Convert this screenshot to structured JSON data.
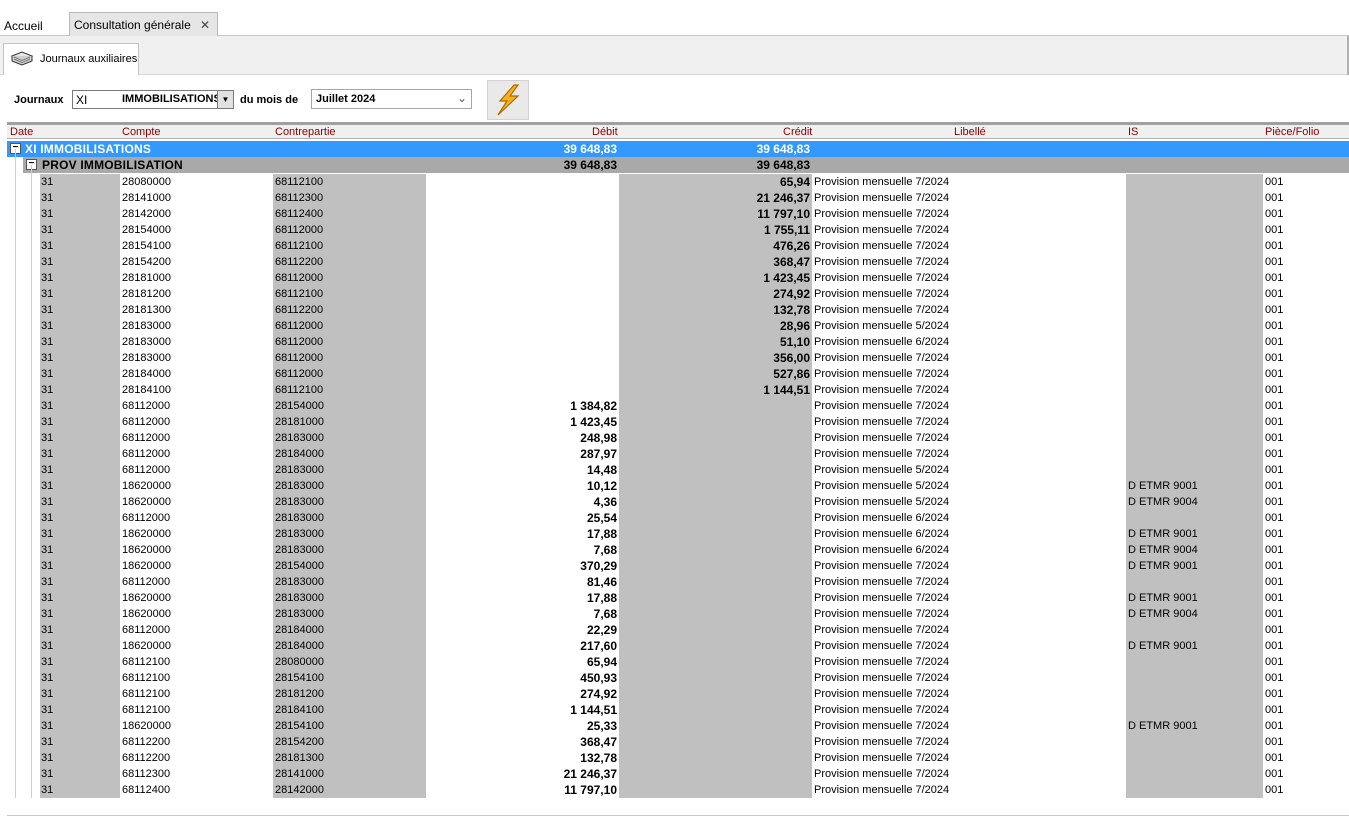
{
  "tabs": {
    "home": "Accueil",
    "active": "Consultation générale",
    "close": "✕"
  },
  "subtab": {
    "label": "Journaux auxiliaires"
  },
  "filters": {
    "journaux_label": "Journaux",
    "journal_code": "XI",
    "journal_name": "IMMOBILISATIONS",
    "mois_label": "du mois de",
    "mois_value": "Juillet 2024"
  },
  "columns": [
    "Date",
    "Compte",
    "Contrepartie",
    "Débit",
    "Crédit",
    "Libellé",
    "IS",
    "Pièce/Folio"
  ],
  "group1": {
    "label": "XI IMMOBILISATIONS",
    "debit": "39 648,83",
    "credit": "39 648,83"
  },
  "group2": {
    "label": "PROV IMMOBILISATION",
    "debit": "39 648,83",
    "credit": "39 648,83"
  },
  "rows": [
    {
      "date": "31",
      "compte": "28080000",
      "contre": "68112100",
      "debit": "",
      "credit": "65,94",
      "libelle": "Provision mensuelle 7/2024",
      "is": "",
      "piece": "001"
    },
    {
      "date": "31",
      "compte": "28141000",
      "contre": "68112300",
      "debit": "",
      "credit": "21 246,37",
      "libelle": "Provision mensuelle 7/2024",
      "is": "",
      "piece": "001"
    },
    {
      "date": "31",
      "compte": "28142000",
      "contre": "68112400",
      "debit": "",
      "credit": "11 797,10",
      "libelle": "Provision mensuelle 7/2024",
      "is": "",
      "piece": "001"
    },
    {
      "date": "31",
      "compte": "28154000",
      "contre": "68112000",
      "debit": "",
      "credit": "1 755,11",
      "libelle": "Provision mensuelle 7/2024",
      "is": "",
      "piece": "001"
    },
    {
      "date": "31",
      "compte": "28154100",
      "contre": "68112100",
      "debit": "",
      "credit": "476,26",
      "libelle": "Provision mensuelle 7/2024",
      "is": "",
      "piece": "001"
    },
    {
      "date": "31",
      "compte": "28154200",
      "contre": "68112200",
      "debit": "",
      "credit": "368,47",
      "libelle": "Provision mensuelle 7/2024",
      "is": "",
      "piece": "001"
    },
    {
      "date": "31",
      "compte": "28181000",
      "contre": "68112000",
      "debit": "",
      "credit": "1 423,45",
      "libelle": "Provision mensuelle 7/2024",
      "is": "",
      "piece": "001"
    },
    {
      "date": "31",
      "compte": "28181200",
      "contre": "68112100",
      "debit": "",
      "credit": "274,92",
      "libelle": "Provision mensuelle 7/2024",
      "is": "",
      "piece": "001"
    },
    {
      "date": "31",
      "compte": "28181300",
      "contre": "68112200",
      "debit": "",
      "credit": "132,78",
      "libelle": "Provision mensuelle 7/2024",
      "is": "",
      "piece": "001"
    },
    {
      "date": "31",
      "compte": "28183000",
      "contre": "68112000",
      "debit": "",
      "credit": "28,96",
      "libelle": "Provision mensuelle 5/2024",
      "is": "",
      "piece": "001"
    },
    {
      "date": "31",
      "compte": "28183000",
      "contre": "68112000",
      "debit": "",
      "credit": "51,10",
      "libelle": "Provision mensuelle 6/2024",
      "is": "",
      "piece": "001"
    },
    {
      "date": "31",
      "compte": "28183000",
      "contre": "68112000",
      "debit": "",
      "credit": "356,00",
      "libelle": "Provision mensuelle 7/2024",
      "is": "",
      "piece": "001"
    },
    {
      "date": "31",
      "compte": "28184000",
      "contre": "68112000",
      "debit": "",
      "credit": "527,86",
      "libelle": "Provision mensuelle 7/2024",
      "is": "",
      "piece": "001"
    },
    {
      "date": "31",
      "compte": "28184100",
      "contre": "68112100",
      "debit": "",
      "credit": "1 144,51",
      "libelle": "Provision mensuelle 7/2024",
      "is": "",
      "piece": "001"
    },
    {
      "date": "31",
      "compte": "68112000",
      "contre": "28154000",
      "debit": "1 384,82",
      "credit": "",
      "libelle": "Provision mensuelle 7/2024",
      "is": "",
      "piece": "001"
    },
    {
      "date": "31",
      "compte": "68112000",
      "contre": "28181000",
      "debit": "1 423,45",
      "credit": "",
      "libelle": "Provision mensuelle 7/2024",
      "is": "",
      "piece": "001"
    },
    {
      "date": "31",
      "compte": "68112000",
      "contre": "28183000",
      "debit": "248,98",
      "credit": "",
      "libelle": "Provision mensuelle 7/2024",
      "is": "",
      "piece": "001"
    },
    {
      "date": "31",
      "compte": "68112000",
      "contre": "28184000",
      "debit": "287,97",
      "credit": "",
      "libelle": "Provision mensuelle 7/2024",
      "is": "",
      "piece": "001"
    },
    {
      "date": "31",
      "compte": "68112000",
      "contre": "28183000",
      "debit": "14,48",
      "credit": "",
      "libelle": "Provision mensuelle 5/2024",
      "is": "",
      "piece": "001"
    },
    {
      "date": "31",
      "compte": "18620000",
      "contre": "28183000",
      "debit": "10,12",
      "credit": "",
      "libelle": "Provision mensuelle 5/2024",
      "is": "D ETMR 9001",
      "piece": "001"
    },
    {
      "date": "31",
      "compte": "18620000",
      "contre": "28183000",
      "debit": "4,36",
      "credit": "",
      "libelle": "Provision mensuelle 5/2024",
      "is": "D ETMR 9004",
      "piece": "001"
    },
    {
      "date": "31",
      "compte": "68112000",
      "contre": "28183000",
      "debit": "25,54",
      "credit": "",
      "libelle": "Provision mensuelle 6/2024",
      "is": "",
      "piece": "001"
    },
    {
      "date": "31",
      "compte": "18620000",
      "contre": "28183000",
      "debit": "17,88",
      "credit": "",
      "libelle": "Provision mensuelle 6/2024",
      "is": "D ETMR 9001",
      "piece": "001"
    },
    {
      "date": "31",
      "compte": "18620000",
      "contre": "28183000",
      "debit": "7,68",
      "credit": "",
      "libelle": "Provision mensuelle 6/2024",
      "is": "D ETMR 9004",
      "piece": "001"
    },
    {
      "date": "31",
      "compte": "18620000",
      "contre": "28154000",
      "debit": "370,29",
      "credit": "",
      "libelle": "Provision mensuelle 7/2024",
      "is": "D ETMR 9001",
      "piece": "001"
    },
    {
      "date": "31",
      "compte": "68112000",
      "contre": "28183000",
      "debit": "81,46",
      "credit": "",
      "libelle": "Provision mensuelle 7/2024",
      "is": "",
      "piece": "001"
    },
    {
      "date": "31",
      "compte": "18620000",
      "contre": "28183000",
      "debit": "17,88",
      "credit": "",
      "libelle": "Provision mensuelle 7/2024",
      "is": "D ETMR 9001",
      "piece": "001"
    },
    {
      "date": "31",
      "compte": "18620000",
      "contre": "28183000",
      "debit": "7,68",
      "credit": "",
      "libelle": "Provision mensuelle 7/2024",
      "is": "D ETMR 9004",
      "piece": "001"
    },
    {
      "date": "31",
      "compte": "68112000",
      "contre": "28184000",
      "debit": "22,29",
      "credit": "",
      "libelle": "Provision mensuelle 7/2024",
      "is": "",
      "piece": "001"
    },
    {
      "date": "31",
      "compte": "18620000",
      "contre": "28184000",
      "debit": "217,60",
      "credit": "",
      "libelle": "Provision mensuelle 7/2024",
      "is": "D ETMR 9001",
      "piece": "001"
    },
    {
      "date": "31",
      "compte": "68112100",
      "contre": "28080000",
      "debit": "65,94",
      "credit": "",
      "libelle": "Provision mensuelle 7/2024",
      "is": "",
      "piece": "001"
    },
    {
      "date": "31",
      "compte": "68112100",
      "contre": "28154100",
      "debit": "450,93",
      "credit": "",
      "libelle": "Provision mensuelle 7/2024",
      "is": "",
      "piece": "001"
    },
    {
      "date": "31",
      "compte": "68112100",
      "contre": "28181200",
      "debit": "274,92",
      "credit": "",
      "libelle": "Provision mensuelle 7/2024",
      "is": "",
      "piece": "001"
    },
    {
      "date": "31",
      "compte": "68112100",
      "contre": "28184100",
      "debit": "1 144,51",
      "credit": "",
      "libelle": "Provision mensuelle 7/2024",
      "is": "",
      "piece": "001"
    },
    {
      "date": "31",
      "compte": "18620000",
      "contre": "28154100",
      "debit": "25,33",
      "credit": "",
      "libelle": "Provision mensuelle 7/2024",
      "is": "D ETMR 9001",
      "piece": "001"
    },
    {
      "date": "31",
      "compte": "68112200",
      "contre": "28154200",
      "debit": "368,47",
      "credit": "",
      "libelle": "Provision mensuelle 7/2024",
      "is": "",
      "piece": "001"
    },
    {
      "date": "31",
      "compte": "68112200",
      "contre": "28181300",
      "debit": "132,78",
      "credit": "",
      "libelle": "Provision mensuelle 7/2024",
      "is": "",
      "piece": "001"
    },
    {
      "date": "31",
      "compte": "68112300",
      "contre": "28141000",
      "debit": "21 246,37",
      "credit": "",
      "libelle": "Provision mensuelle 7/2024",
      "is": "",
      "piece": "001"
    },
    {
      "date": "31",
      "compte": "68112400",
      "contre": "28142000",
      "debit": "11 797,10",
      "credit": "",
      "libelle": "Provision mensuelle 7/2024",
      "is": "",
      "piece": "001"
    }
  ]
}
